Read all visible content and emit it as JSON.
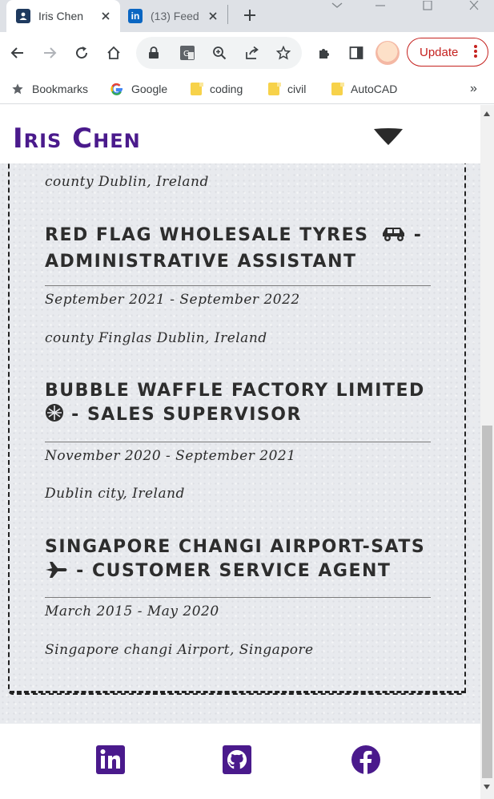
{
  "browser": {
    "tabs": [
      {
        "title": "Iris Chen",
        "favicon": "contact-card-icon",
        "active": true
      },
      {
        "title": "(13) Feed",
        "favicon": "linkedin-icon",
        "active": false
      }
    ],
    "bookmarks_bar": {
      "items": [
        {
          "label": "Bookmarks",
          "icon": "star-icon"
        },
        {
          "label": "Google",
          "icon": "google-icon"
        },
        {
          "label": "coding",
          "icon": "folder-icon"
        },
        {
          "label": "civil",
          "icon": "folder-icon"
        },
        {
          "label": "AutoCAD",
          "icon": "folder-icon"
        }
      ],
      "overflow": "»"
    },
    "update_label": "Update",
    "favicon_li_text": "in"
  },
  "site": {
    "brand": "Iris Chen",
    "accent_color": "#4a1a8c"
  },
  "experience": {
    "prev_location": "county Dublin, Ireland",
    "jobs": [
      {
        "title": "Red Flag Wholesale Tyres",
        "title_rest": "- Administrative Assistant",
        "icon": "car-icon",
        "dates": "September 2021 - September 2022",
        "location": "county Finglas Dublin, Ireland"
      },
      {
        "title": "Bubble Waffle Factory Limited",
        "title_rest": "- Sales Supervisor",
        "icon": "waffle-icon",
        "dates": "November 2020 - September 2021",
        "location": "Dublin city, Ireland"
      },
      {
        "title": "Singapore Changi Airport-SATS",
        "title_rest": "- Customer Service Agent",
        "icon": "airplane-icon",
        "dates": "March 2015 - May 2020",
        "location": "Singapore changi Airport, Singapore"
      }
    ]
  },
  "footer": {
    "links": [
      {
        "name": "linkedin",
        "icon": "linkedin-icon"
      },
      {
        "name": "github",
        "icon": "github-icon"
      },
      {
        "name": "facebook",
        "icon": "facebook-icon"
      }
    ]
  }
}
